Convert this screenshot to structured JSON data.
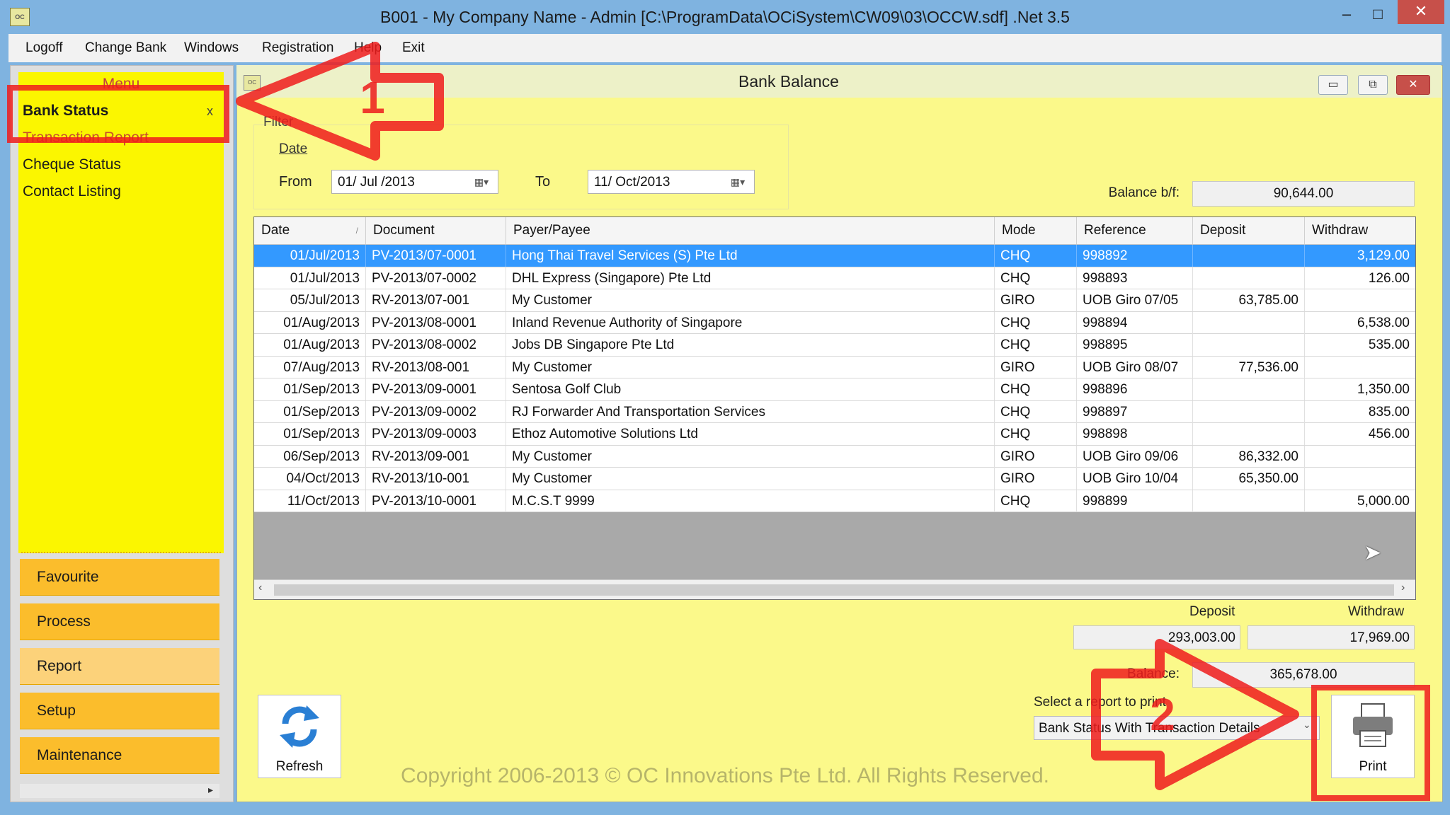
{
  "window": {
    "title": "B001 - My Company Name - Admin [C:\\ProgramData\\OCiSystem\\CW09\\03\\OCCW.sdf] .Net 3.5",
    "icon": "app-icon",
    "min_glyph": "–",
    "max_glyph": "□",
    "close_glyph": "✕"
  },
  "menubar": [
    "Logoff",
    "Change Bank",
    "Windows",
    "Registration",
    "Help",
    "Exit"
  ],
  "sidebar": {
    "title": "Menu",
    "items": [
      "Bank Status",
      "Transaction Report",
      "Cheque Status",
      "Contact Listing"
    ],
    "close_glyph": "x",
    "categories": [
      "Favourite",
      "Process",
      "Report",
      "Setup",
      "Maintenance"
    ]
  },
  "child": {
    "title": "Bank Balance",
    "min_glyph": "▭",
    "max_glyph": "⧉",
    "close_glyph": "✕"
  },
  "filter": {
    "label": "Filter",
    "date_label": "Date",
    "from_label": "From",
    "from_value": "01/ Jul /2013",
    "to_label": "To",
    "to_value": "11/ Oct/2013"
  },
  "balance_bf": {
    "label": "Balance b/f:",
    "value": "90,644.00"
  },
  "table": {
    "columns": [
      "Date",
      "Document",
      "Payer/Payee",
      "Mode",
      "Reference",
      "Deposit",
      "Withdraw"
    ],
    "rows": [
      [
        "01/Jul/2013",
        "PV-2013/07-0001",
        "Hong Thai Travel Services (S) Pte Ltd",
        "CHQ",
        "998892",
        "",
        "3,129.00"
      ],
      [
        "01/Jul/2013",
        "PV-2013/07-0002",
        "DHL Express (Singapore) Pte Ltd",
        "CHQ",
        "998893",
        "",
        "126.00"
      ],
      [
        "05/Jul/2013",
        "RV-2013/07-001",
        "My Customer",
        "GIRO",
        "UOB Giro 07/05",
        "63,785.00",
        ""
      ],
      [
        "01/Aug/2013",
        "PV-2013/08-0001",
        "Inland Revenue Authority of Singapore",
        "CHQ",
        "998894",
        "",
        "6,538.00"
      ],
      [
        "01/Aug/2013",
        "PV-2013/08-0002",
        "Jobs DB Singapore Pte Ltd",
        "CHQ",
        "998895",
        "",
        "535.00"
      ],
      [
        "07/Aug/2013",
        "RV-2013/08-001",
        "My Customer",
        "GIRO",
        "UOB Giro 08/07",
        "77,536.00",
        ""
      ],
      [
        "01/Sep/2013",
        "PV-2013/09-0001",
        "Sentosa Golf Club",
        "CHQ",
        "998896",
        "",
        "1,350.00"
      ],
      [
        "01/Sep/2013",
        "PV-2013/09-0002",
        "RJ Forwarder And Transportation Services",
        "CHQ",
        "998897",
        "",
        "835.00"
      ],
      [
        "01/Sep/2013",
        "PV-2013/09-0003",
        "Ethoz Automotive Solutions Ltd",
        "CHQ",
        "998898",
        "",
        "456.00"
      ],
      [
        "06/Sep/2013",
        "RV-2013/09-001",
        "My Customer",
        "GIRO",
        "UOB Giro 09/06",
        "86,332.00",
        ""
      ],
      [
        "04/Oct/2013",
        "RV-2013/10-001",
        "My Customer",
        "GIRO",
        "UOB Giro 10/04",
        "65,350.00",
        ""
      ],
      [
        "11/Oct/2013",
        "PV-2013/10-0001",
        "M.C.S.T 9999",
        "CHQ",
        "998899",
        "",
        "5,000.00"
      ]
    ],
    "selected_row": 0
  },
  "totals": {
    "deposit_label": "Deposit",
    "withdraw_label": "Withdraw",
    "deposit": "293,003.00",
    "withdraw": "17,969.00",
    "balance_label": "Balance:",
    "balance": "365,678.00"
  },
  "report": {
    "label": "Select a report to print",
    "selected": "Bank Status With Transaction Details"
  },
  "buttons": {
    "refresh": "Refresh",
    "print": "Print"
  },
  "copyright": "Copyright 2006-2013 © OC Innovations Pte Ltd. All Rights Reserved.",
  "annotations": {
    "step1": "1",
    "step2": "2",
    "color": "#ee1c1c"
  },
  "colors": {
    "sidebar_yellow": "#fbf600",
    "category_orange": "#fbbd2c",
    "child_bg": "#fbf98a",
    "selection_blue": "#3399ff",
    "titlebar_blue": "#7fb3e0"
  }
}
